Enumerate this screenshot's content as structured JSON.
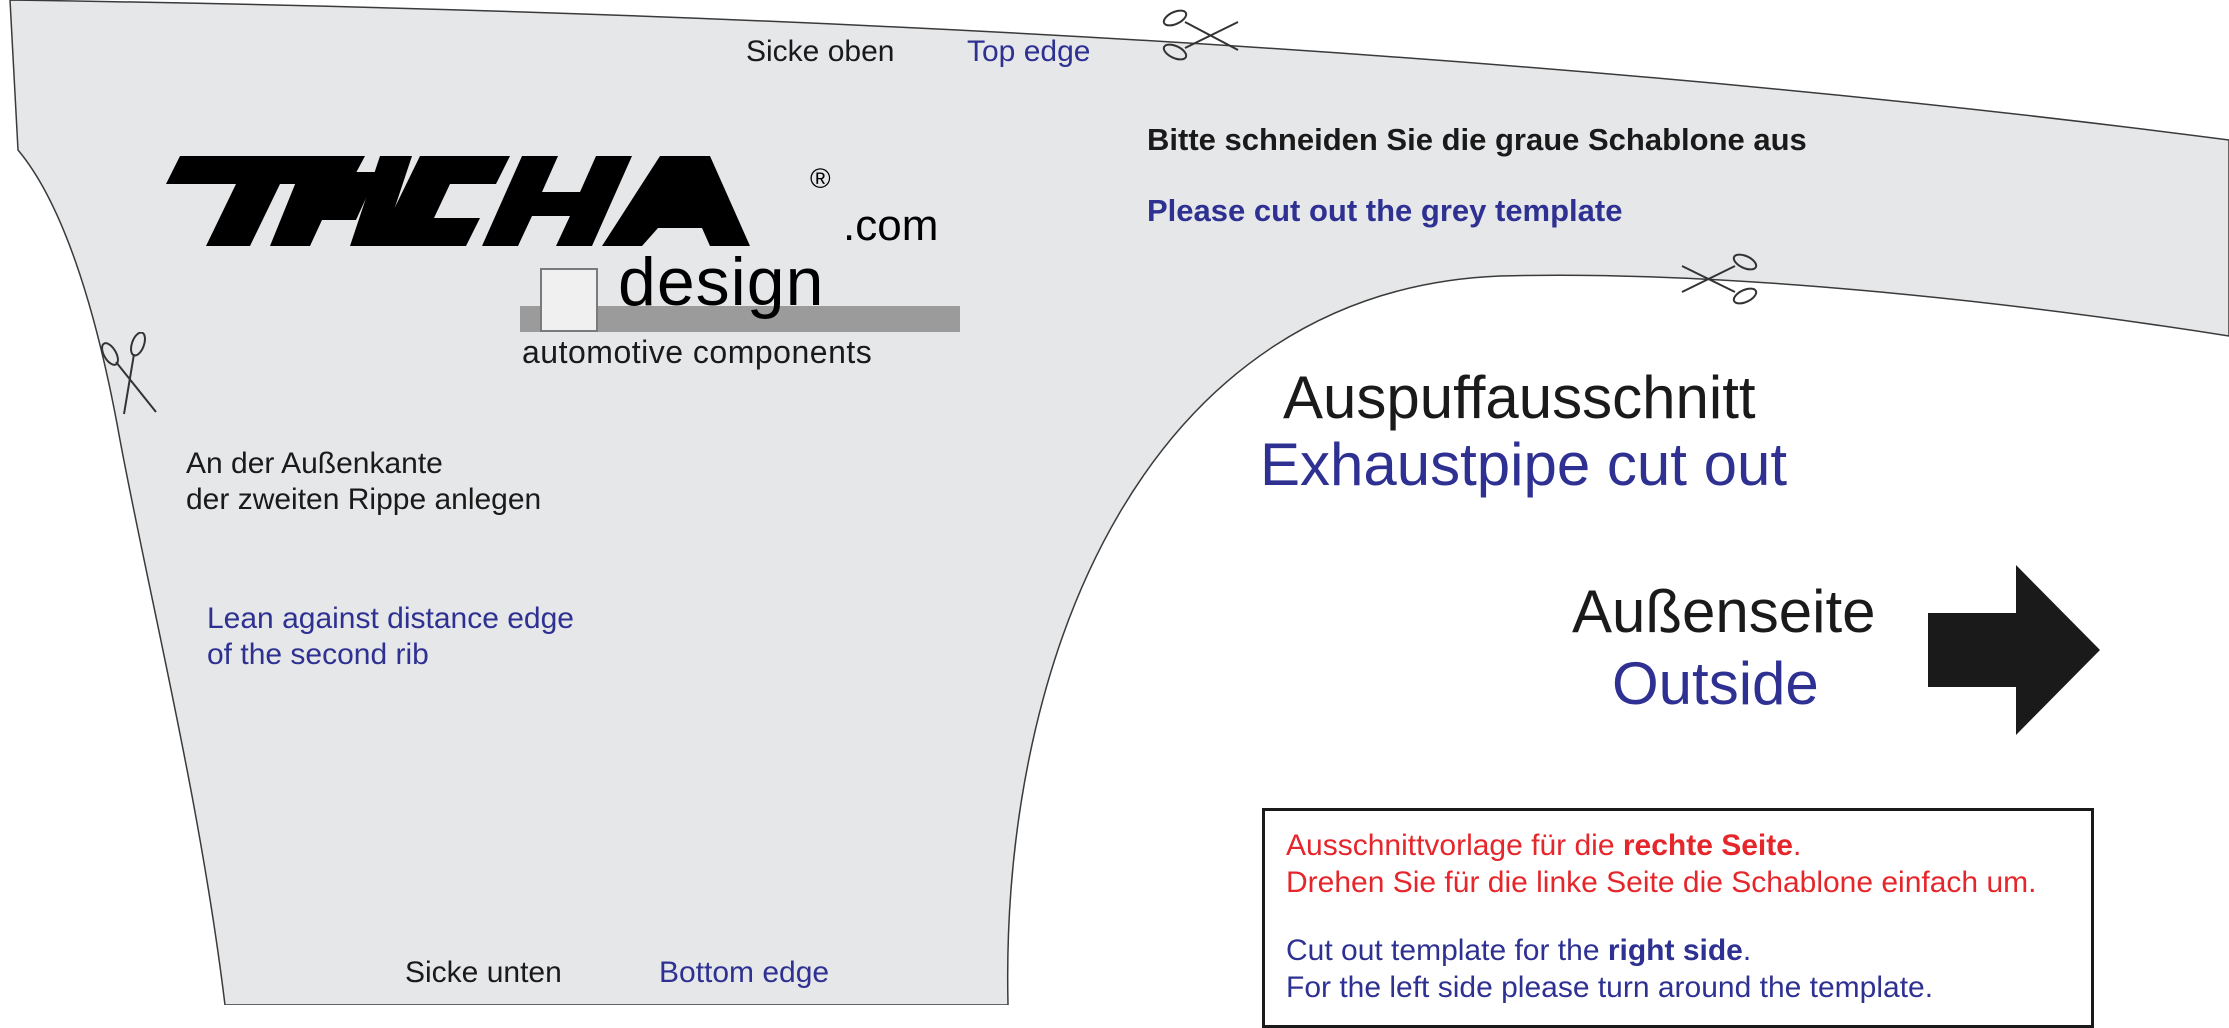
{
  "template": {
    "colors": {
      "template_fill": "#e6e7e9",
      "german_text": "#1a1a1a",
      "english_text": "#2e3192",
      "notice_text": "#e5262b"
    }
  },
  "labels": {
    "top_de": "Sicke oben",
    "top_en": "Top edge",
    "bottom_de": "Sicke unten",
    "bottom_en": "Bottom edge"
  },
  "instructions": {
    "cut_de": "Bitte schneiden Sie die graue Schablone aus",
    "cut_en": "Please cut out the grey template"
  },
  "logo": {
    "brand": "PIECHA",
    "registered": "®",
    "domain": ".com",
    "design": "design",
    "tagline": "automotive components"
  },
  "placement": {
    "de_line1": "An der Außenkante",
    "de_line2": "der zweiten Rippe anlegen",
    "en_line1": "Lean against distance edge",
    "en_line2": "of the second rib"
  },
  "exhaust": {
    "de": "Auspuffausschnitt",
    "en": "Exhaustpipe cut out"
  },
  "side": {
    "de": "Außenseite",
    "en": "Outside",
    "arrow_icon": "arrow-right-icon"
  },
  "notice": {
    "de_line1_prefix": "Ausschnittvorlage für die ",
    "de_line1_bold": "rechte Seite",
    "de_line1_suffix": ".",
    "de_line2": "Drehen Sie für die linke Seite die Schablone einfach um.",
    "en_line1_prefix": "Cut out template for the ",
    "en_line1_bold": "right side",
    "en_line1_suffix": ".",
    "en_line2": "For the left side please turn around the template."
  },
  "icons": {
    "scissors": "scissors-icon"
  }
}
